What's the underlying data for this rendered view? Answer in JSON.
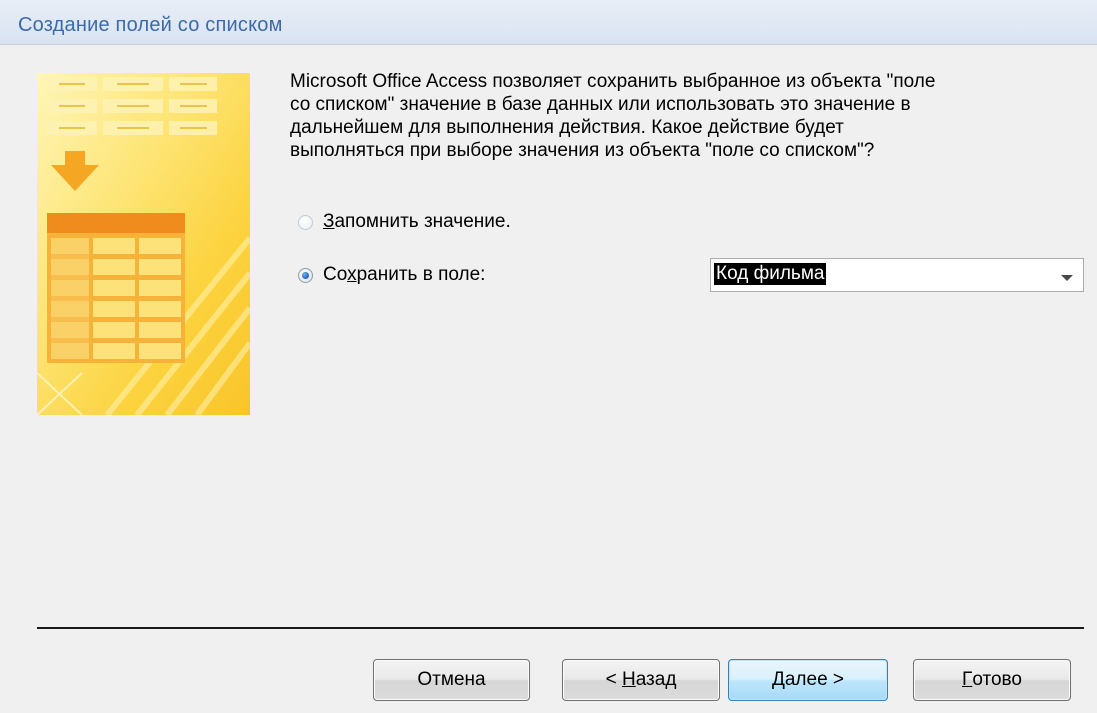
{
  "window": {
    "title": "Создание полей со списком"
  },
  "content": {
    "prompt": "Microsoft Office Access позволяет сохранить выбранное из объекта \"поле\nсо списком\" значение в базе данных или использовать это значение в\nдальнейшем для выполнения действия.  Какое действие будет\nвыполняться при выборе значения из объекта \"поле со списком\"?",
    "options": [
      {
        "label_underlined": "З",
        "label_rest": "апомнить значение.",
        "selected": false,
        "enabled": false
      },
      {
        "label_before": "Со",
        "label_underlined": "х",
        "label_rest": "ранить в поле:",
        "selected": true,
        "enabled": true
      }
    ],
    "field_select": {
      "value": "Код фильма"
    }
  },
  "buttons": {
    "cancel": "Отмена",
    "back_prefix": "< ",
    "back_underlined": "Н",
    "back_rest": "азад",
    "next_underlined": "Д",
    "next_rest": "алее >",
    "finish_underlined": "Г",
    "finish_rest": "отово"
  },
  "colors": {
    "title_text": "#3c6aa8",
    "illustration_yellow": "#fbd43c",
    "illustration_orange": "#f5a623",
    "selection_bg": "#000000",
    "default_button_border": "#3c7fb1"
  },
  "icons": {
    "illustration": "wizard-table-illustration",
    "dropdown": "chevron-down-icon"
  }
}
